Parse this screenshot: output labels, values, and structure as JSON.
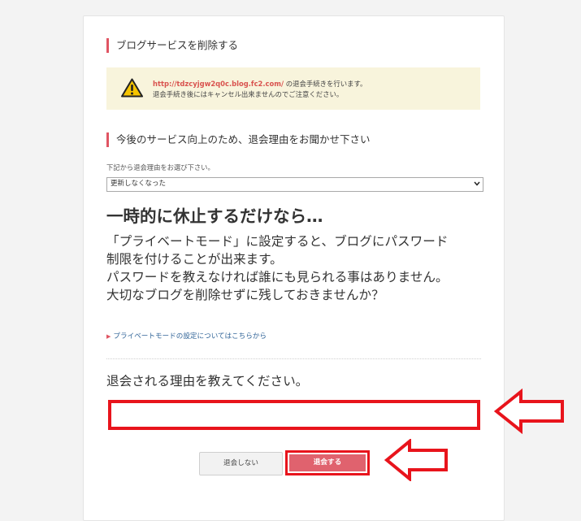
{
  "colors": {
    "accent": "#e05563",
    "warning_bg": "#f8f4dc",
    "highlight": "#e8141c",
    "submit_bg": "#e0626e",
    "link": "#336699"
  },
  "delete_section": {
    "title": "ブログサービスを削除する",
    "warning": {
      "icon": "warning-triangle-icon",
      "url": "http://tdzcyjgw2q0c.blog.fc2.com/",
      "line1_suffix": " の退会手続きを行います。",
      "line2": "退会手続き後にはキャンセル出来ませんのでご注意ください。"
    }
  },
  "reason_section": {
    "title": "今後のサービス向上のため、退会理由をお聞かせ下さい",
    "select_hint": "下記から退会理由をお選び下さい。",
    "selected_reason": "更新しなくなった"
  },
  "suggestion": {
    "headline": "一時的に休止するだけなら…",
    "lines": [
      "「プライベートモード」に設定すると、ブログにパスワード",
      "制限を付けることが出来ます。",
      "パスワードを教えなければ誰にも見られる事はありません。",
      "大切なブログを削除せずに残しておきませんか？"
    ],
    "link_text": "プライベートモードの設定についてはこちらから"
  },
  "free_reason": {
    "prompt": "退会される理由を教えてください。",
    "value": ""
  },
  "buttons": {
    "cancel": "退会しない",
    "submit": "退会する"
  }
}
